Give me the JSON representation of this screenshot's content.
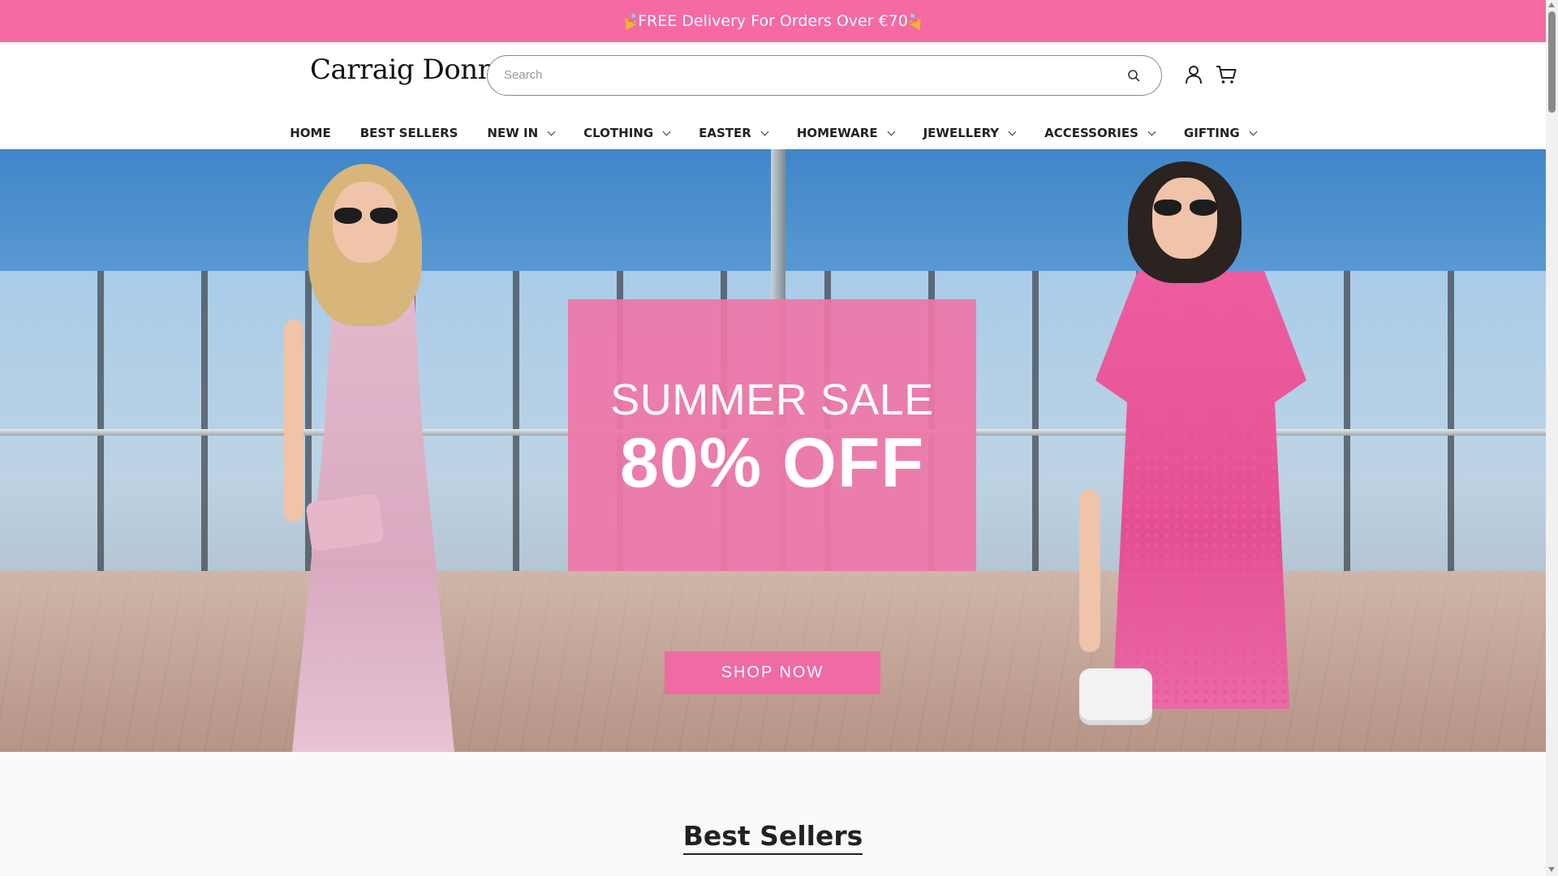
{
  "announcement": {
    "text": "FREE Delivery For Orders Over €70",
    "icon_left": "party-popper-icon",
    "icon_right": "party-popper-icon",
    "background": "#f56aa2"
  },
  "header": {
    "logo": "Carraig Donn",
    "search": {
      "placeholder": "Search",
      "value": "",
      "icon": "search-icon"
    },
    "icons": [
      "user-icon",
      "cart-icon"
    ]
  },
  "nav": {
    "items": [
      {
        "label": "HOME",
        "dropdown": false
      },
      {
        "label": "BEST SELLERS",
        "dropdown": false
      },
      {
        "label": "NEW IN",
        "dropdown": true
      },
      {
        "label": "CLOTHING",
        "dropdown": true
      },
      {
        "label": "EASTER",
        "dropdown": true
      },
      {
        "label": "HOMEWARE",
        "dropdown": true
      },
      {
        "label": "JEWELLERY",
        "dropdown": true
      },
      {
        "label": "ACCESSORIES",
        "dropdown": true
      },
      {
        "label": "GIFTING",
        "dropdown": true
      }
    ]
  },
  "hero": {
    "title": "SUMMER SALE",
    "headline": "80% OFF",
    "cta": "SHOP NOW",
    "accent": "#f06aa4"
  },
  "best_sellers": {
    "title": "Best Sellers"
  }
}
